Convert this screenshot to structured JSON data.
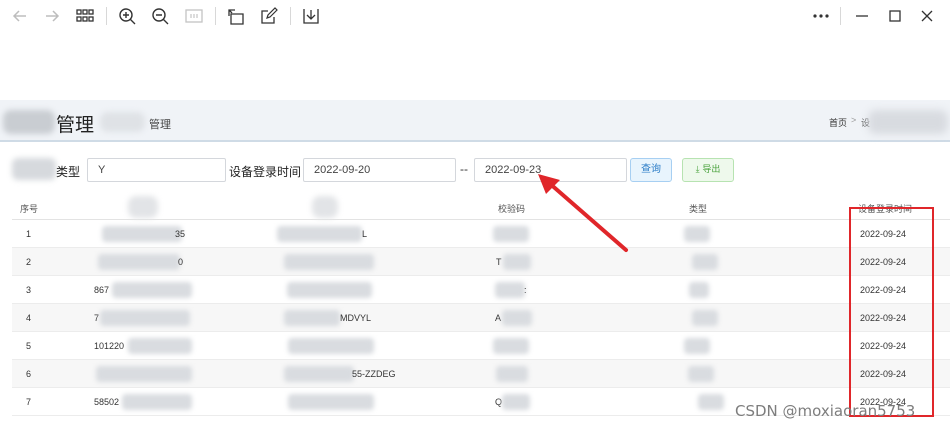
{
  "toolbar": {
    "icons": [
      "back-arrow-icon",
      "forward-arrow-icon",
      "grid-icon",
      "zoom-in-icon",
      "zoom-out-icon",
      "fit-page-icon",
      "rotate-icon",
      "edit-icon",
      "download-icon",
      "more-icon",
      "minimize-icon",
      "maximize-icon",
      "close-icon"
    ]
  },
  "header": {
    "title": "管理",
    "subtitle": "管理",
    "breadcrumb_home": "首页",
    "breadcrumb_sep": ">",
    "breadcrumb_second": "设"
  },
  "search": {
    "type_label": "类型",
    "type_value": "Y",
    "login_time_label": "设备登录时间",
    "start_date": "2022-09-20",
    "range_sep": "--",
    "end_date": "2022-09-23",
    "query_button": "查询",
    "export_button": "⤓ 导出"
  },
  "table": {
    "columns": [
      "序号",
      "校验码",
      "类型",
      "设备登录时间"
    ],
    "rows": [
      {
        "index": "1",
        "col1": "35",
        "col2": "L",
        "col3": "",
        "date": "2022-09-24"
      },
      {
        "index": "2",
        "col1": "0",
        "col2": "",
        "col3": "T",
        "date": "2022-09-24"
      },
      {
        "index": "3",
        "col1": "867",
        "col2": "",
        "col3": ":",
        "date": "2022-09-24"
      },
      {
        "index": "4",
        "col1": "7",
        "col2": "MDVYL",
        "col3": "A",
        "date": "2022-09-24"
      },
      {
        "index": "5",
        "col1": "101220",
        "col2": "",
        "col3": "",
        "date": "2022-09-24"
      },
      {
        "index": "6",
        "col1": "",
        "col2": "55-ZZDEG",
        "col3": "",
        "date": "2022-09-24"
      },
      {
        "index": "7",
        "col1": "58502",
        "col2": "",
        "col3": "Q",
        "date": "2022-09-24"
      }
    ]
  },
  "watermark": "CSDN @moxiaoran5753",
  "colors": {
    "annotation_red": "#e0262a",
    "query_blue": "#2a7cc7",
    "export_green": "#4aa23d"
  }
}
